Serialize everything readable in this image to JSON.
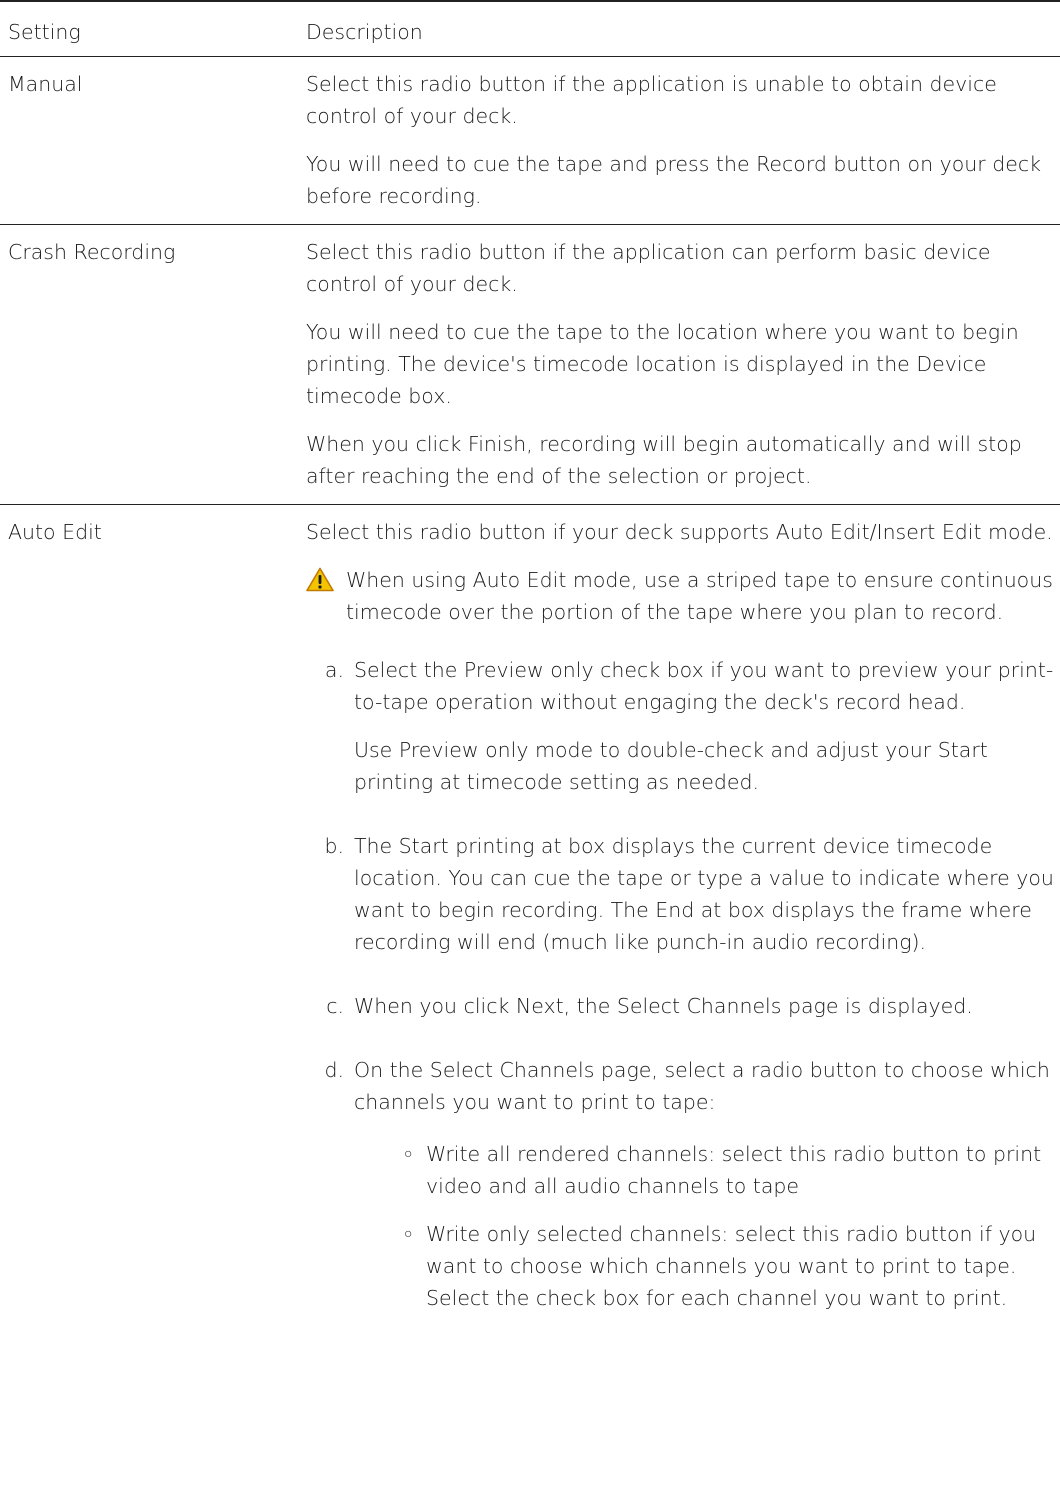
{
  "table": {
    "header": {
      "setting": "Setting",
      "description": "Description"
    },
    "rows": [
      {
        "setting": "Manual",
        "paragraphs": [
          "Select this radio button if the application is unable to obtain device control of your deck.",
          "You will need to cue the tape and press the Record button on your deck before recording."
        ]
      },
      {
        "setting": "Crash Recording",
        "paragraphs": [
          "Select this radio button if the application can perform basic device control of your deck.",
          "You will need to cue the tape to the location where you want to begin printing. The device's timecode location is displayed in the Device timecode box.",
          "When you click Finish, recording will begin automatically and will stop after reaching the end of the selection or project."
        ]
      },
      {
        "setting": "Auto Edit",
        "intro": "Select this radio button if your deck supports Auto Edit/Insert Edit mode.",
        "note": {
          "icon": "warning-icon",
          "text": "When using Auto Edit mode, use a striped tape to ensure continuous timecode over the portion of the tape where you plan to record."
        },
        "steps": [
          {
            "marker": "a.",
            "paragraphs": [
              "Select the Preview only check box if you want to preview your print-to-tape operation without engaging the deck's record head.",
              "Use Preview only mode to double-check and adjust your Start printing at timecode setting as needed."
            ]
          },
          {
            "marker": "b.",
            "paragraphs": [
              "The Start printing at box displays the current device timecode location. You can cue the tape or type a value to indicate where you want to begin recording. The End at box displays the frame where recording will end (much like punch-in audio recording)."
            ]
          },
          {
            "marker": "c.",
            "paragraphs": [
              "When you click Next, the Select Channels page is displayed."
            ]
          },
          {
            "marker": "d.",
            "paragraphs": [
              "On the Select Channels page, select a radio button to choose which channels you want to print to tape:"
            ],
            "bullets": [
              "Write all rendered channels: select this radio button to print video and all audio channels to tape",
              "Write only selected channels: select this radio button if you want to choose which channels you want to print to tape. Select the check box for each channel you want to print."
            ]
          }
        ]
      }
    ]
  },
  "colors": {
    "text": "#1a1a1a",
    "rule": "#222222",
    "warning_fill": "#f5c400",
    "warning_stroke": "#c07a00"
  }
}
